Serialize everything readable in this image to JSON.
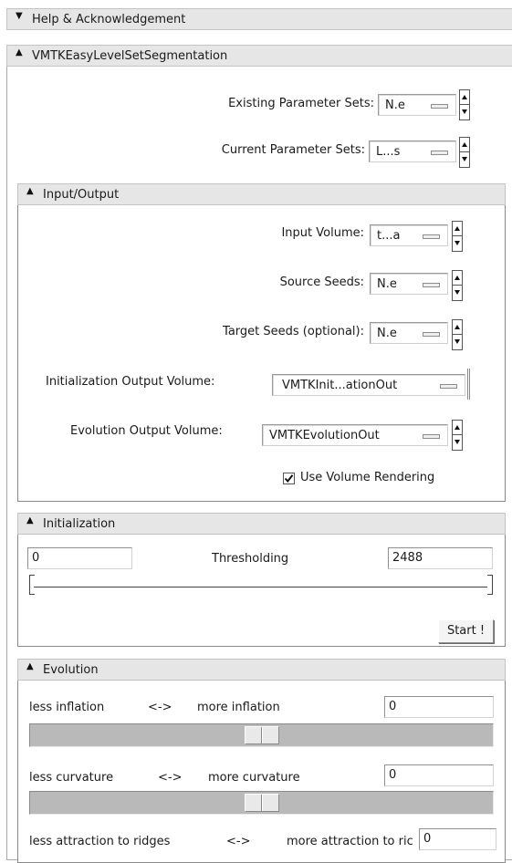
{
  "help_panel": {
    "title": "Help & Acknowledgement",
    "state_icon": "triangle-down"
  },
  "module_panel": {
    "title": "VMTKEasyLevelSetSegmentation",
    "state_icon": "triangle-up"
  },
  "parameters": {
    "existing_label": "Existing Parameter Sets:",
    "existing_value": "N.e",
    "current_label": "Current Parameter Sets:",
    "current_value": "L...s"
  },
  "io": {
    "title": "Input/Output",
    "input_volume_label": "Input Volume:",
    "input_volume_value": "t...a",
    "source_seeds_label": "Source Seeds:",
    "source_seeds_value": "N.e",
    "target_seeds_label": "Target Seeds (optional):",
    "target_seeds_value": "N.e",
    "init_output_label": "Initialization Output Volume:",
    "init_output_value": "VMTKInit...ationOut",
    "evolution_output_label": "Evolution Output Volume:",
    "evolution_output_value": "VMTKEvolutionOut",
    "use_volume_rendering_label": "Use Volume Rendering",
    "use_volume_rendering_checked": true
  },
  "initialization": {
    "title": "Initialization",
    "threshold_min": "0",
    "threshold_label": "Thresholding",
    "threshold_max": "2488",
    "start_button": "Start !"
  },
  "evolution": {
    "title": "Evolution",
    "inflation_left": "less inflation",
    "inflation_arrow": "<->",
    "inflation_right": "more inflation",
    "inflation_value": "0",
    "inflation_slider_fraction": 0.5,
    "curvature_left": "less curvature",
    "curvature_arrow": "<->",
    "curvature_right": "more curvature",
    "curvature_value": "0",
    "curvature_slider_fraction": 0.5,
    "attraction_left": "less attraction to ridges",
    "attraction_arrow": "<->",
    "attraction_right": "more attraction to ric",
    "attraction_value": "0"
  },
  "colors": {
    "header_bg": "#e6e6e6",
    "trough": "#b9b9b9",
    "frame_border": "#8a8a8a"
  }
}
